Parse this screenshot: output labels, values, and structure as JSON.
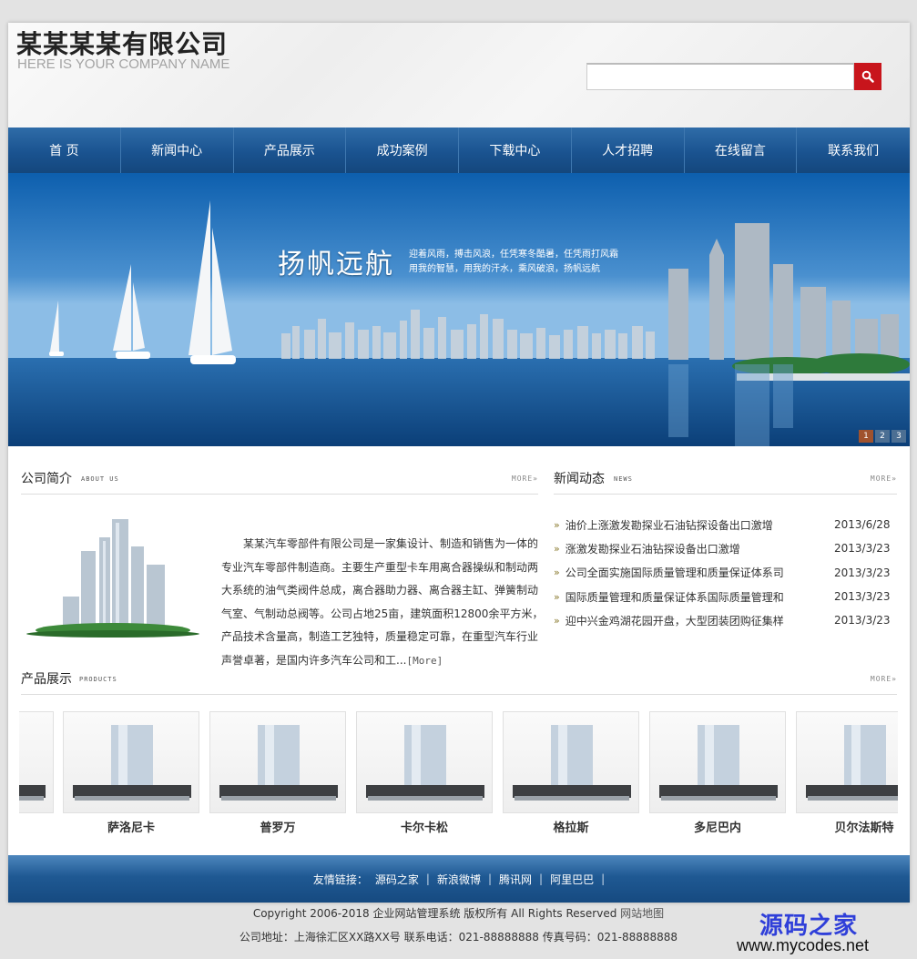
{
  "header": {
    "company_cn": "某某某某有限公司",
    "company_en": "HERE IS YOUR COMPANY NAME",
    "search": {
      "value": "",
      "icon": "search-icon"
    }
  },
  "nav": [
    "首 页",
    "新闻中心",
    "产品展示",
    "成功案例",
    "下载中心",
    "人才招聘",
    "在线留言",
    "联系我们"
  ],
  "banner": {
    "title": "扬帆远航",
    "subtitle_line1": "迎着风雨，搏击风浪，任凭寒冬酷暑，任凭雨打风霜",
    "subtitle_line2": "用我的智慧，用我的汗水，乘风破浪，扬帆远航",
    "pages": [
      "1",
      "2",
      "3"
    ],
    "active_page": "1"
  },
  "about": {
    "title": "公司简介",
    "title_en": "ABOUT US",
    "more": "MORE»",
    "text": "某某汽车零部件有限公司是一家集设计、制造和销售为一体的专业汽车零部件制造商。主要生产重型卡车用离合器操纵和制动两大系统的油气类阀件总成，离合器助力器、离合器主缸、弹簧制动气室、气制动总阀等。公司占地25亩，建筑面积12800余平方米，产品技术含量高，制造工艺独特，质量稳定可靠，在重型汽车行业声誉卓著，是国内许多汽车公司和工...",
    "read_more": "[More]"
  },
  "news": {
    "title": "新闻动态",
    "title_en": "NEWS",
    "more": "MORE»",
    "items": [
      {
        "title": "油价上涨激发勘探业石油钻探设备出口激增",
        "date": "2013/6/28"
      },
      {
        "title": "涨激发勘探业石油钻探设备出口激增",
        "date": "2013/3/23"
      },
      {
        "title": "公司全面实施国际质量管理和质量保证体系司",
        "date": "2013/3/23"
      },
      {
        "title": "国际质量管理和质量保证体系国际质量管理和",
        "date": "2013/3/23"
      },
      {
        "title": "迎中兴金鸡湖花园开盘，大型团装团购征集样",
        "date": "2013/3/23"
      }
    ]
  },
  "products": {
    "title": "产品展示",
    "title_en": "PRODUCTS",
    "more": "MORE»",
    "items": [
      "萨洛尼卡",
      "普罗万",
      "卡尔卡松",
      "格拉斯",
      "多尼巴内",
      "贝尔法斯特"
    ]
  },
  "footer": {
    "links_label": "友情链接：",
    "links": [
      "源码之家",
      "新浪微博",
      "腾讯网",
      "阿里巴巴"
    ],
    "copyright": "Copyright 2006-2018 企业网站管理系统 版权所有 All Rights Reserved",
    "sitemap": "网站地图",
    "address": "公司地址：上海徐汇区XX路XX号  联系电话：021-88888888  传真号码：021-88888888"
  },
  "watermark": {
    "cn": "源码之家",
    "url": "www.mycodes.net"
  },
  "colors": {
    "nav_blue": "#1a5390",
    "search_red": "#c8151c",
    "watermark_blue": "#2f3fd9"
  }
}
